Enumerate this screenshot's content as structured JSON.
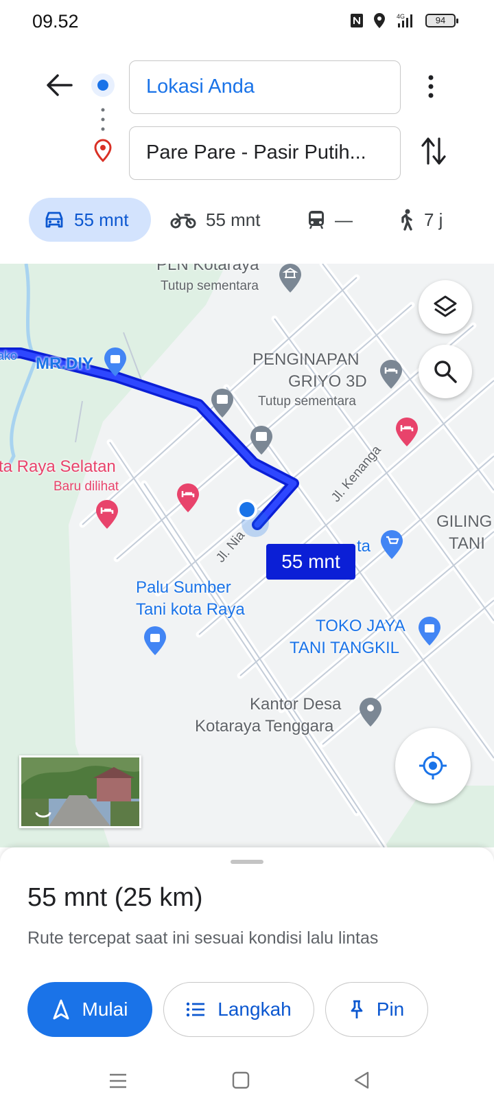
{
  "status_bar": {
    "time": "09.52",
    "battery": "94"
  },
  "directions": {
    "origin": "Lokasi Anda",
    "destination": "Pare Pare - Pasir Putih...",
    "modes": [
      {
        "icon": "car-icon",
        "label": "55 mnt"
      },
      {
        "icon": "motorcycle-icon",
        "label": "55 mnt"
      },
      {
        "icon": "transit-icon",
        "label": "—"
      },
      {
        "icon": "walk-icon",
        "label": "7 j"
      }
    ]
  },
  "map": {
    "pois": {
      "pln": "PLN Kotaraya",
      "pln_status": "Tutup sementara",
      "penginapan_1": "PENGINAPAN",
      "penginapan_2": "GRIYO 3D",
      "penginapan_status": "Tutup sementara",
      "mrdiy": "MR.DIY",
      "ako": "ako",
      "raya_selatan": "ta Raya Selatan",
      "raya_selatan_status": "Baru dilihat",
      "palu_1": "Palu Sumber",
      "palu_2": "Tani kota Raya",
      "toko_1": "TOKO JAYA",
      "toko_2": "TANI TANGKIL",
      "kantor_1": "Kantor Desa",
      "kantor_2": "Kotaraya Tenggara",
      "giling_1": "GILING",
      "giling_2": "TANI",
      "ta": "ta",
      "street_kenanga": "Jl. Kenanga",
      "street_nia": "Jl. Nia"
    },
    "route_time": "55 mnt"
  },
  "sheet": {
    "summary": "55 mnt (25 km)",
    "subtitle": "Rute tercepat saat ini sesuai kondisi lalu lintas",
    "start": "Mulai",
    "steps": "Langkah",
    "pin": "Pin"
  },
  "colors": {
    "accent": "#1a73e8",
    "route": "#1a2cf0",
    "map_bg": "#dff0e4",
    "hotel": "#e8436b"
  }
}
